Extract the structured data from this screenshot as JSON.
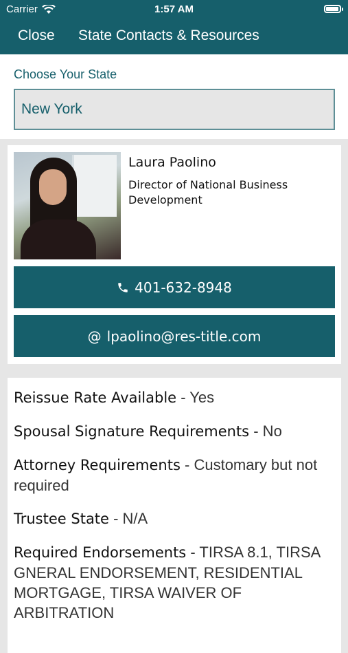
{
  "status_bar": {
    "carrier": "Carrier",
    "time": "1:57 AM"
  },
  "nav": {
    "close_label": "Close",
    "title": "State Contacts & Resources"
  },
  "state_picker": {
    "label": "Choose Your State",
    "value": "New York"
  },
  "contact": {
    "name": "Laura Paolino",
    "role": "Director of National Business Development",
    "phone": "401-632-8948",
    "email": "lpaolino@res-title.com"
  },
  "details": [
    {
      "key": "Reissue Rate Available",
      "value": " - Yes"
    },
    {
      "key": "Spousal Signature Requirements",
      "value": " - No"
    },
    {
      "key": "Attorney Requirements",
      "value": " - Customary but not required"
    },
    {
      "key": "Trustee State",
      "value": " - N/A"
    },
    {
      "key": "Required Endorsements",
      "value": " - TIRSA 8.1, TIRSA GNERAL ENDORSEMENT, RESIDENTIAL MORTGAGE, TIRSA WAIVER OF ARBITRATION"
    }
  ],
  "icons": {
    "phone": "phone-icon",
    "email": "at-icon",
    "wifi": "wifi-icon",
    "battery": "battery-icon"
  },
  "colors": {
    "primary": "#165f6b",
    "background": "#e6e6e6"
  }
}
